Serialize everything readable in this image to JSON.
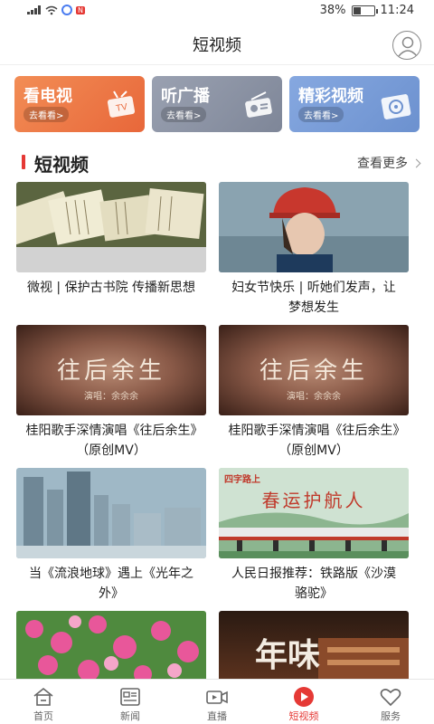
{
  "status": {
    "battery": "38%",
    "time": "11:24",
    "battery_level": 0.38
  },
  "header": {
    "title": "短视频"
  },
  "categories": [
    {
      "title": "看电视",
      "sub": "去看看>",
      "color": "#ef7d45",
      "icon": "tv-icon"
    },
    {
      "title": "听广播",
      "sub": "去看看>",
      "color": "#8d95a6",
      "icon": "radio-icon"
    },
    {
      "title": "精彩视频",
      "sub": "去看看>",
      "color": "#7a9ed8",
      "icon": "video-disc-icon"
    }
  ],
  "section": {
    "title": "短视频",
    "more": "查看更多"
  },
  "videos": [
    {
      "caption": "微视 | 保护古书院 传播新思想"
    },
    {
      "caption": "妇女节快乐 | 听她们发声，让梦想发生"
    },
    {
      "caption": "桂阳歌手深情演唱《往后余生》（原创MV）",
      "overlay": "往后余生",
      "sub": "演唱：余余余"
    },
    {
      "caption": "桂阳歌手深情演唱《往后余生》（原创MV）",
      "overlay": "往后余生",
      "sub": "演唱：余余余"
    },
    {
      "caption": "当《流浪地球》遇上《光年之外》"
    },
    {
      "caption": "人民日报推荐：铁路版《沙漠骆驼》",
      "overlay": "春运护航人",
      "tag": "四字路上"
    },
    {
      "caption": ""
    },
    {
      "caption": "",
      "overlay": "年味"
    }
  ],
  "tabs": [
    {
      "label": "首页",
      "icon": "home-icon"
    },
    {
      "label": "新闻",
      "icon": "news-icon"
    },
    {
      "label": "直播",
      "icon": "live-camera-icon"
    },
    {
      "label": "短视频",
      "icon": "play-icon"
    },
    {
      "label": "服务",
      "icon": "heart-icon"
    }
  ],
  "active_tab": "短视频"
}
